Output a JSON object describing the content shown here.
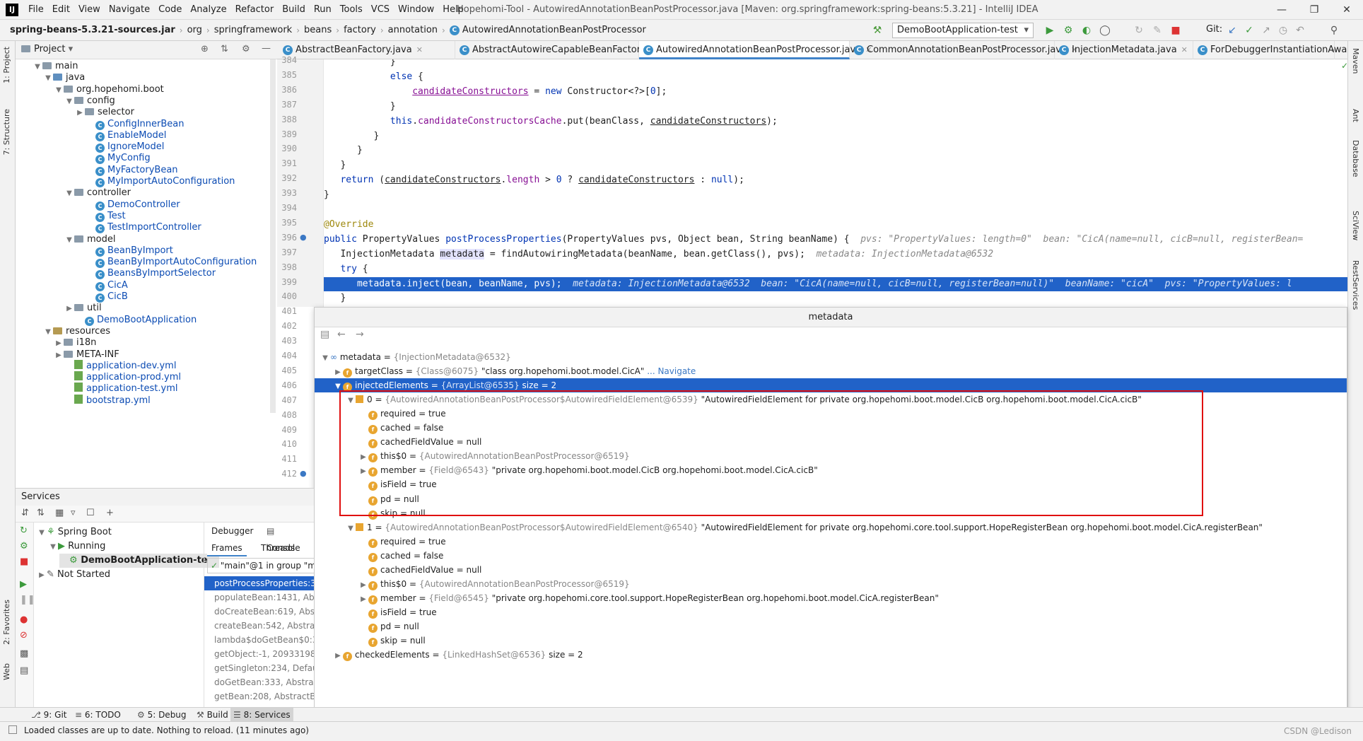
{
  "window": {
    "title": "Hopehomi-Tool - AutowiredAnnotationBeanPostProcessor.java [Maven: org.springframework:spring-beans:5.3.21] - IntelliJ IDEA",
    "logo": "IJ"
  },
  "menu": [
    "File",
    "Edit",
    "View",
    "Navigate",
    "Code",
    "Analyze",
    "Refactor",
    "Build",
    "Run",
    "Tools",
    "VCS",
    "Window",
    "Help"
  ],
  "breadcrumbs": [
    "spring-beans-5.3.21-sources.jar",
    "org",
    "springframework",
    "beans",
    "factory",
    "annotation",
    "AutowiredAnnotationBeanPostProcessor"
  ],
  "run_config": "DemoBootApplication-test",
  "git_label": "Git:",
  "project": {
    "title": "Project",
    "tree": [
      {
        "label": "main",
        "depth": 2,
        "kind": "folder",
        "arrow": "down"
      },
      {
        "label": "java",
        "depth": 3,
        "kind": "src",
        "arrow": "down"
      },
      {
        "label": "org.hopehomi.boot",
        "depth": 4,
        "kind": "folder",
        "arrow": "down"
      },
      {
        "label": "config",
        "depth": 5,
        "kind": "folder",
        "arrow": "down"
      },
      {
        "label": "selector",
        "depth": 6,
        "kind": "folder",
        "arrow": "right"
      },
      {
        "label": "ConfigInnerBean",
        "depth": 7,
        "kind": "class"
      },
      {
        "label": "EnableModel",
        "depth": 7,
        "kind": "class"
      },
      {
        "label": "IgnoreModel",
        "depth": 7,
        "kind": "class"
      },
      {
        "label": "MyConfig",
        "depth": 7,
        "kind": "class"
      },
      {
        "label": "MyFactoryBean",
        "depth": 7,
        "kind": "class"
      },
      {
        "label": "MyImportAutoConfiguration",
        "depth": 7,
        "kind": "class"
      },
      {
        "label": "controller",
        "depth": 5,
        "kind": "folder",
        "arrow": "down"
      },
      {
        "label": "DemoController",
        "depth": 7,
        "kind": "class"
      },
      {
        "label": "Test",
        "depth": 7,
        "kind": "class"
      },
      {
        "label": "TestImportController",
        "depth": 7,
        "kind": "class"
      },
      {
        "label": "model",
        "depth": 5,
        "kind": "folder",
        "arrow": "down"
      },
      {
        "label": "BeanByImport",
        "depth": 7,
        "kind": "class"
      },
      {
        "label": "BeanByImportAutoConfiguration",
        "depth": 7,
        "kind": "class"
      },
      {
        "label": "BeansByImportSelector",
        "depth": 7,
        "kind": "class"
      },
      {
        "label": "CicA",
        "depth": 7,
        "kind": "class"
      },
      {
        "label": "CicB",
        "depth": 7,
        "kind": "class"
      },
      {
        "label": "util",
        "depth": 5,
        "kind": "folder",
        "arrow": "right"
      },
      {
        "label": "DemoBootApplication",
        "depth": 6,
        "kind": "class"
      },
      {
        "label": "resources",
        "depth": 3,
        "kind": "res",
        "arrow": "down"
      },
      {
        "label": "i18n",
        "depth": 4,
        "kind": "folder",
        "arrow": "right"
      },
      {
        "label": "META-INF",
        "depth": 4,
        "kind": "folder",
        "arrow": "right"
      },
      {
        "label": "application-dev.yml",
        "depth": 5,
        "kind": "yml"
      },
      {
        "label": "application-prod.yml",
        "depth": 5,
        "kind": "yml"
      },
      {
        "label": "application-test.yml",
        "depth": 5,
        "kind": "yml"
      },
      {
        "label": "bootstrap.yml",
        "depth": 5,
        "kind": "yml"
      }
    ]
  },
  "editor_tabs": [
    {
      "label": "AbstractBeanFactory.java",
      "active": false
    },
    {
      "label": "AbstractAutowireCapableBeanFactory.java",
      "active": false
    },
    {
      "label": "AutowiredAnnotationBeanPostProcessor.java",
      "active": true
    },
    {
      "label": "CommonAnnotationBeanPostProcessor.java",
      "active": false
    },
    {
      "label": "InjectionMetadata.java",
      "active": false
    },
    {
      "label": "ForDebuggerInstantiationAwa",
      "active": false
    }
  ],
  "code_lines": [
    {
      "n": "384",
      "h": "            }"
    },
    {
      "n": "385",
      "h": "            <span class=\"kw\">else</span> {"
    },
    {
      "n": "386",
      "h": "                <span class=\"fld u\">candidateConstructors</span> = <span class=\"kw\">new</span> Constructor&lt;?&gt;[<span class=\"kw\">0</span>];"
    },
    {
      "n": "387",
      "h": "            }"
    },
    {
      "n": "388",
      "h": "            <span class=\"kw\">this</span>.<span class=\"fld\">candidateConstructorsCache</span>.put(beanClass, <span class=\"u\">candidateConstructors</span>);"
    },
    {
      "n": "389",
      "h": "         }"
    },
    {
      "n": "390",
      "h": "      }"
    },
    {
      "n": "391",
      "h": "   }"
    },
    {
      "n": "392",
      "h": "   <span class=\"kw\">return</span> (<span class=\"u\">candidateConstructors</span>.<span class=\"fld\">length</span> &gt; <span class=\"kw\">0</span> ? <span class=\"u\">candidateConstructors</span> : <span class=\"kw\">null</span>);"
    },
    {
      "n": "393",
      "h": "}"
    },
    {
      "n": "394",
      "h": ""
    },
    {
      "n": "395",
      "h": "<span class=\"ann\">@Override</span>"
    },
    {
      "n": "396",
      "h": "<span class=\"kw\">public</span> PropertyValues <span class=\"kw\">postProcessProperties</span>(PropertyValues pvs, Object bean, String beanName) {  <span class=\"hint\">pvs: \"PropertyValues: length=0\"  bean: \"CicA(name=null, cicB=null, registerBean=</span>"
    },
    {
      "n": "397",
      "h": "   InjectionMetadata <span style=\"background:#e4e4ff\">metadata</span> = findAutowiringMetadata(beanName, bean.getClass(), pvs);  <span class=\"hint\">metadata: InjectionMetadata@6532</span>"
    },
    {
      "n": "398",
      "h": "   <span class=\"kw\">try</span> {"
    },
    {
      "n": "399",
      "h": "      metadata.inject(bean, beanName, pvs);  <span class=\"hint\">metadata: InjectionMetadata@6532  bean: \"CicA(name=null, cicB=null, registerBean=null)\"  beanName: \"cicA\"  pvs: \"PropertyValues: l</span>",
      "hl": true
    },
    {
      "n": "400",
      "h": "   }"
    },
    {
      "n": "401",
      "h": ""
    },
    {
      "n": "402",
      "h": ""
    },
    {
      "n": "403",
      "h": ""
    },
    {
      "n": "404",
      "h": ""
    },
    {
      "n": "405",
      "h": ""
    },
    {
      "n": "406",
      "h": ""
    },
    {
      "n": "407",
      "h": ""
    },
    {
      "n": "408",
      "h": ""
    },
    {
      "n": "409",
      "h": ""
    },
    {
      "n": "410",
      "h": ""
    },
    {
      "n": "411",
      "h": ""
    },
    {
      "n": "412",
      "h": ""
    }
  ],
  "popup": {
    "title": "metadata",
    "rows": [
      {
        "depth": 0,
        "arrow": "down",
        "icon": "oo",
        "name": "metadata",
        "type": "{InjectionMetadata@6532}",
        "value": ""
      },
      {
        "depth": 1,
        "arrow": "right",
        "icon": "f",
        "name": "targetClass",
        "type": "{Class@6075}",
        "value": "\"class org.hopehomi.boot.model.CicA\"",
        "link": "... Navigate"
      },
      {
        "depth": 1,
        "arrow": "down",
        "icon": "f",
        "name": "injectedElements",
        "type": "{ArrayList@6535}",
        "value": "size = 2",
        "sel": true
      },
      {
        "depth": 2,
        "arrow": "down",
        "icon": "list",
        "name": "0",
        "type": "{AutowiredAnnotationBeanPostProcessor$AutowiredFieldElement@6539}",
        "value": "\"AutowiredFieldElement for private org.hopehomi.boot.model.CicB org.hopehomi.boot.model.CicA.cicB\""
      },
      {
        "depth": 3,
        "arrow": "",
        "icon": "f",
        "name": "required",
        "type": "",
        "value": "true"
      },
      {
        "depth": 3,
        "arrow": "",
        "icon": "f",
        "name": "cached",
        "type": "",
        "value": "false"
      },
      {
        "depth": 3,
        "arrow": "",
        "icon": "f",
        "name": "cachedFieldValue",
        "type": "",
        "value": "null"
      },
      {
        "depth": 3,
        "arrow": "right",
        "icon": "f",
        "name": "this$0",
        "type": "{AutowiredAnnotationBeanPostProcessor@6519}",
        "value": ""
      },
      {
        "depth": 3,
        "arrow": "right",
        "icon": "f",
        "name": "member",
        "type": "{Field@6543}",
        "value": "\"private org.hopehomi.boot.model.CicB org.hopehomi.boot.model.CicA.cicB\""
      },
      {
        "depth": 3,
        "arrow": "",
        "icon": "f",
        "name": "isField",
        "type": "",
        "value": "true"
      },
      {
        "depth": 3,
        "arrow": "",
        "icon": "f",
        "name": "pd",
        "type": "",
        "value": "null"
      },
      {
        "depth": 3,
        "arrow": "",
        "icon": "f",
        "name": "skip",
        "type": "",
        "value": "null"
      },
      {
        "depth": 2,
        "arrow": "down",
        "icon": "list",
        "name": "1",
        "type": "{AutowiredAnnotationBeanPostProcessor$AutowiredFieldElement@6540}",
        "value": "\"AutowiredFieldElement for private org.hopehomi.core.tool.support.HopeRegisterBean org.hopehomi.boot.model.CicA.registerBean\""
      },
      {
        "depth": 3,
        "arrow": "",
        "icon": "f",
        "name": "required",
        "type": "",
        "value": "true"
      },
      {
        "depth": 3,
        "arrow": "",
        "icon": "f",
        "name": "cached",
        "type": "",
        "value": "false"
      },
      {
        "depth": 3,
        "arrow": "",
        "icon": "f",
        "name": "cachedFieldValue",
        "type": "",
        "value": "null"
      },
      {
        "depth": 3,
        "arrow": "right",
        "icon": "f",
        "name": "this$0",
        "type": "{AutowiredAnnotationBeanPostProcessor@6519}",
        "value": ""
      },
      {
        "depth": 3,
        "arrow": "right",
        "icon": "f",
        "name": "member",
        "type": "{Field@6545}",
        "value": "\"private org.hopehomi.core.tool.support.HopeRegisterBean org.hopehomi.boot.model.CicA.registerBean\""
      },
      {
        "depth": 3,
        "arrow": "",
        "icon": "f",
        "name": "isField",
        "type": "",
        "value": "true"
      },
      {
        "depth": 3,
        "arrow": "",
        "icon": "f",
        "name": "pd",
        "type": "",
        "value": "null"
      },
      {
        "depth": 3,
        "arrow": "",
        "icon": "f",
        "name": "skip",
        "type": "",
        "value": "null"
      },
      {
        "depth": 1,
        "arrow": "right",
        "icon": "f",
        "name": "checkedElements",
        "type": "{LinkedHashSet@6536}",
        "value": "size = 2"
      }
    ]
  },
  "services": {
    "title": "Services",
    "tree": [
      {
        "label": "Spring Boot",
        "depth": 0,
        "arrow": "down",
        "bold": false
      },
      {
        "label": "Running",
        "depth": 1,
        "arrow": "down",
        "bold": false
      },
      {
        "label": "DemoBootApplication-te",
        "depth": 2,
        "arrow": "",
        "bold": true
      },
      {
        "label": "Not Started",
        "depth": 0,
        "arrow": "right",
        "bold": false
      }
    ],
    "debugger_tab": "Debugger",
    "console_tab": "Console",
    "frames_tab": "Frames",
    "threads_tab": "Threads",
    "thread": "\"main\"@1 in group \"m",
    "frames": [
      "postProcessProperties:3",
      "populateBean:1431, Abs",
      "doCreateBean:619, Abst",
      "createBean:542, Abstrac",
      "lambda$doGetBean$0:3",
      "getObject:-1, 209331984",
      "getSingleton:234, Defau",
      "doGetBean:333, Abstrac",
      "getBean:208, AbstractBe"
    ]
  },
  "bottom_tabs": [
    {
      "label": "9: Git",
      "active": false
    },
    {
      "label": "6: TODO",
      "active": false
    },
    {
      "label": "5: Debug",
      "active": false
    },
    {
      "label": "Build",
      "active": false
    },
    {
      "label": "8: Services",
      "active": true
    }
  ],
  "left_stripe": [
    "1: Project",
    "7: Structure",
    "2: Favorites",
    "Web"
  ],
  "right_stripe": [
    "Maven",
    "Ant",
    "Database",
    "SciView",
    "RestServices"
  ],
  "status": "Loaded classes are up to date. Nothing to reload. (11 minutes ago)",
  "watermark": "CSDN @Ledison"
}
